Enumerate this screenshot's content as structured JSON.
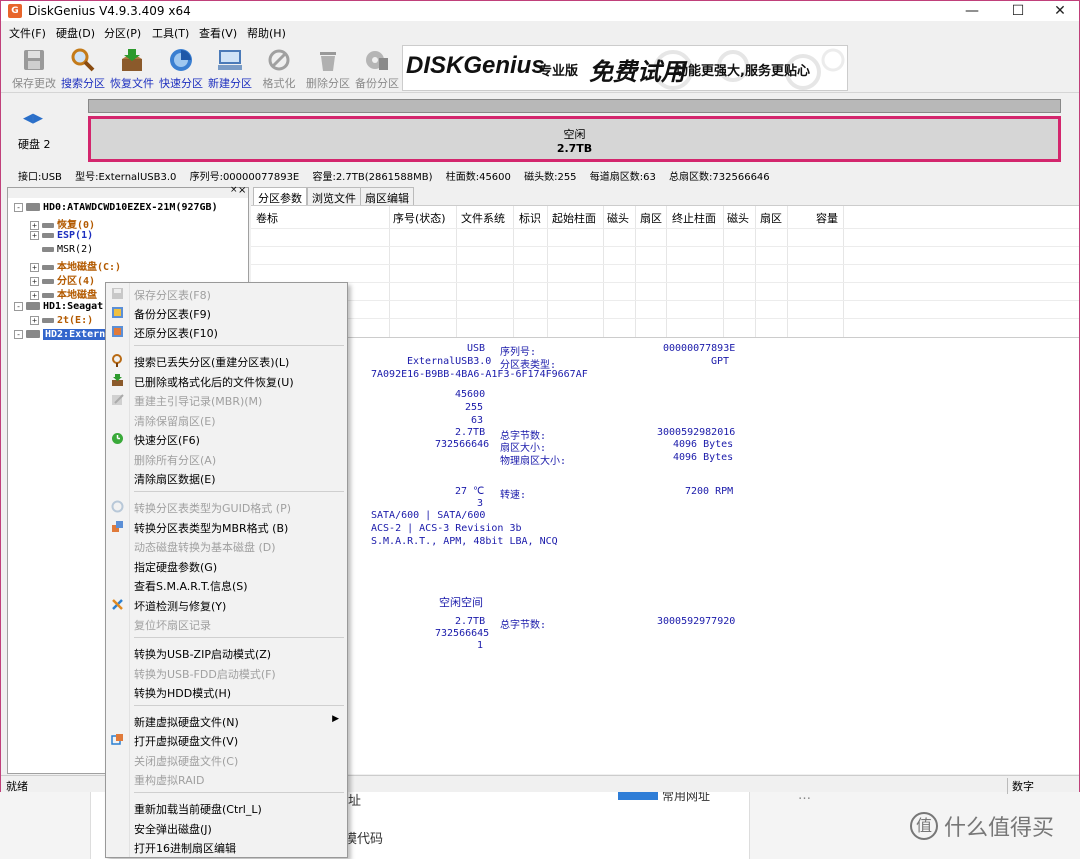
{
  "window": {
    "title": "DiskGenius V4.9.3.409 x64",
    "app_icon": "G",
    "controls": [
      "minimize-icon",
      "maximize-icon",
      "close-icon"
    ]
  },
  "menubar": [
    "文件(F)",
    "硬盘(D)",
    "分区(P)",
    "工具(T)",
    "查看(V)",
    "帮助(H)"
  ],
  "toolbar": [
    {
      "label": "保存更改",
      "icon": "save-icon",
      "disabled": true
    },
    {
      "label": "搜索分区",
      "icon": "magnifier-icon",
      "disabled": false
    },
    {
      "label": "恢复文件",
      "icon": "recover-box-icon",
      "disabled": false
    },
    {
      "label": "快速分区",
      "icon": "quick-partition-icon",
      "disabled": false
    },
    {
      "label": "新建分区",
      "icon": "new-partition-icon",
      "disabled": false
    },
    {
      "label": "格式化",
      "icon": "format-icon",
      "disabled": true
    },
    {
      "label": "删除分区",
      "icon": "trash-icon",
      "disabled": true
    },
    {
      "label": "备份分区",
      "icon": "backup-icon",
      "disabled": true
    }
  ],
  "banner": {
    "brand": "DISKGenius",
    "edition": "专业版",
    "slogan_1": "免费试用",
    "slogan_2": "功能更强大,服务更贴心"
  },
  "diskmap": {
    "disk_label": "硬盘 2",
    "free_label": "空闲",
    "free_size": "2.7TB"
  },
  "disk_info": [
    "接口:USB",
    "型号:ExternalUSB3.0",
    "序列号:00000077893E",
    "容量:2.7TB(2861588MB)",
    "柱面数:45600",
    "磁头数:255",
    "每道扇区数:63",
    "总扇区数:732566646"
  ],
  "tree": {
    "hd0": "HD0:ATAWDCWD10EZEX-21M(927GB)",
    "hd0_items": [
      "恢复(0)",
      "ESP(1)",
      "MSR(2)",
      "本地磁盘(C:)",
      "分区(4)",
      "本地磁盘"
    ],
    "hd1": "HD1:Seagat",
    "hd1_items": [
      "2t(E:)"
    ],
    "hd2": "HD2:Extern"
  },
  "tabs": [
    "分区参数",
    "浏览文件",
    "扇区编辑"
  ],
  "columns": [
    "卷标",
    "序号(状态)",
    "文件系统",
    "标识",
    "起始柱面",
    "磁头",
    "扇区",
    "终止柱面",
    "磁头",
    "扇区",
    "容量"
  ],
  "details": {
    "interface": "USB",
    "model": "ExternalUSB3.0",
    "guid": "7A092E16-B9BB-4BA6-A1F3-6F174F9667AF",
    "serial_label": "序列号:",
    "serial": "00000077893E",
    "pt_label": "分区表类型:",
    "pt": "GPT",
    "cylinders": "45600",
    "heads": "255",
    "sectors": "63",
    "capacity": "2.7TB",
    "total_sectors": "732566646",
    "total_bytes_label": "总字节数:",
    "total_bytes": "3000592982016",
    "sector_size_label": "扇区大小:",
    "sector_size": "4096 Bytes",
    "phys_sector_label": "物理扇区大小:",
    "phys_sector": "4096 Bytes",
    "temp": "27 ℃",
    "num3": "3",
    "rpm_label": "转速:",
    "rpm": "7200 RPM",
    "sata": "SATA/600 | SATA/600",
    "acs": "ACS-2 | ACS-3 Revision 3b",
    "smart": "S.M.A.R.T., APM, 48bit LBA, NCQ",
    "free_space_title": "空闲空间",
    "free_cap": "2.7TB",
    "free_sectors": "732566645",
    "free_start": "1",
    "free_bytes_label": "总字节数:",
    "free_bytes": "3000592977920"
  },
  "statusbar": {
    "left": "就绪",
    "right": "数字"
  },
  "context_menu": [
    {
      "label": "保存分区表(F8)",
      "disabled": true,
      "icon": "save-icon"
    },
    {
      "label": "备份分区表(F9)",
      "disabled": false,
      "icon": "backup-table-icon"
    },
    {
      "label": "还原分区表(F10)",
      "disabled": false,
      "icon": "restore-table-icon"
    },
    {
      "sep": true
    },
    {
      "label": "搜索已丢失分区(重建分区表)(L)",
      "disabled": false,
      "icon": "search-icon"
    },
    {
      "label": "已删除或格式化后的文件恢复(U)",
      "disabled": false,
      "icon": "recover-icon"
    },
    {
      "label": "重建主引导记录(MBR)(M)",
      "disabled": true,
      "icon": "mbr-icon"
    },
    {
      "label": "清除保留扇区(E)",
      "disabled": true
    },
    {
      "label": "快速分区(F6)",
      "disabled": false,
      "icon": "clock-icon"
    },
    {
      "label": "删除所有分区(A)",
      "disabled": true
    },
    {
      "label": "清除扇区数据(E)",
      "disabled": false
    },
    {
      "sep": true
    },
    {
      "label": "转换分区表类型为GUID格式 (P)",
      "disabled": true,
      "icon": "convert-icon"
    },
    {
      "label": "转换分区表类型为MBR格式 (B)",
      "disabled": false,
      "icon": "convert-mbr-icon"
    },
    {
      "label": "动态磁盘转换为基本磁盘 (D)",
      "disabled": true
    },
    {
      "label": "指定硬盘参数(G)",
      "disabled": false
    },
    {
      "label": "查看S.M.A.R.T.信息(S)",
      "disabled": false
    },
    {
      "label": "坏道检测与修复(Y)",
      "disabled": false,
      "icon": "tools-icon"
    },
    {
      "label": "复位坏扇区记录",
      "disabled": true
    },
    {
      "sep": true
    },
    {
      "label": "转换为USB-ZIP启动模式(Z)",
      "disabled": false
    },
    {
      "label": "转换为USB-FDD启动模式(F)",
      "disabled": true
    },
    {
      "label": "转换为HDD模式(H)",
      "disabled": false
    },
    {
      "sep": true
    },
    {
      "label": "新建虚拟硬盘文件(N)",
      "disabled": false,
      "submenu": true
    },
    {
      "label": "打开虚拟硬盘文件(V)",
      "disabled": false,
      "icon": "open-vdisk-icon"
    },
    {
      "label": "关闭虚拟硬盘文件(C)",
      "disabled": true
    },
    {
      "label": "重构虚拟RAID",
      "disabled": true
    },
    {
      "sep": true
    },
    {
      "label": "重新加载当前硬盘(Ctrl_L)",
      "disabled": false
    },
    {
      "label": "安全弹出磁盘(J)",
      "disabled": false
    },
    {
      "label": "打开16进制扇区编辑",
      "disabled": false
    }
  ],
  "background": {
    "text_1": "址",
    "text_2": "模代码",
    "text_3": "常用网址",
    "text_4": "…",
    "watermark_icon": "值",
    "watermark": "什么值得买"
  }
}
